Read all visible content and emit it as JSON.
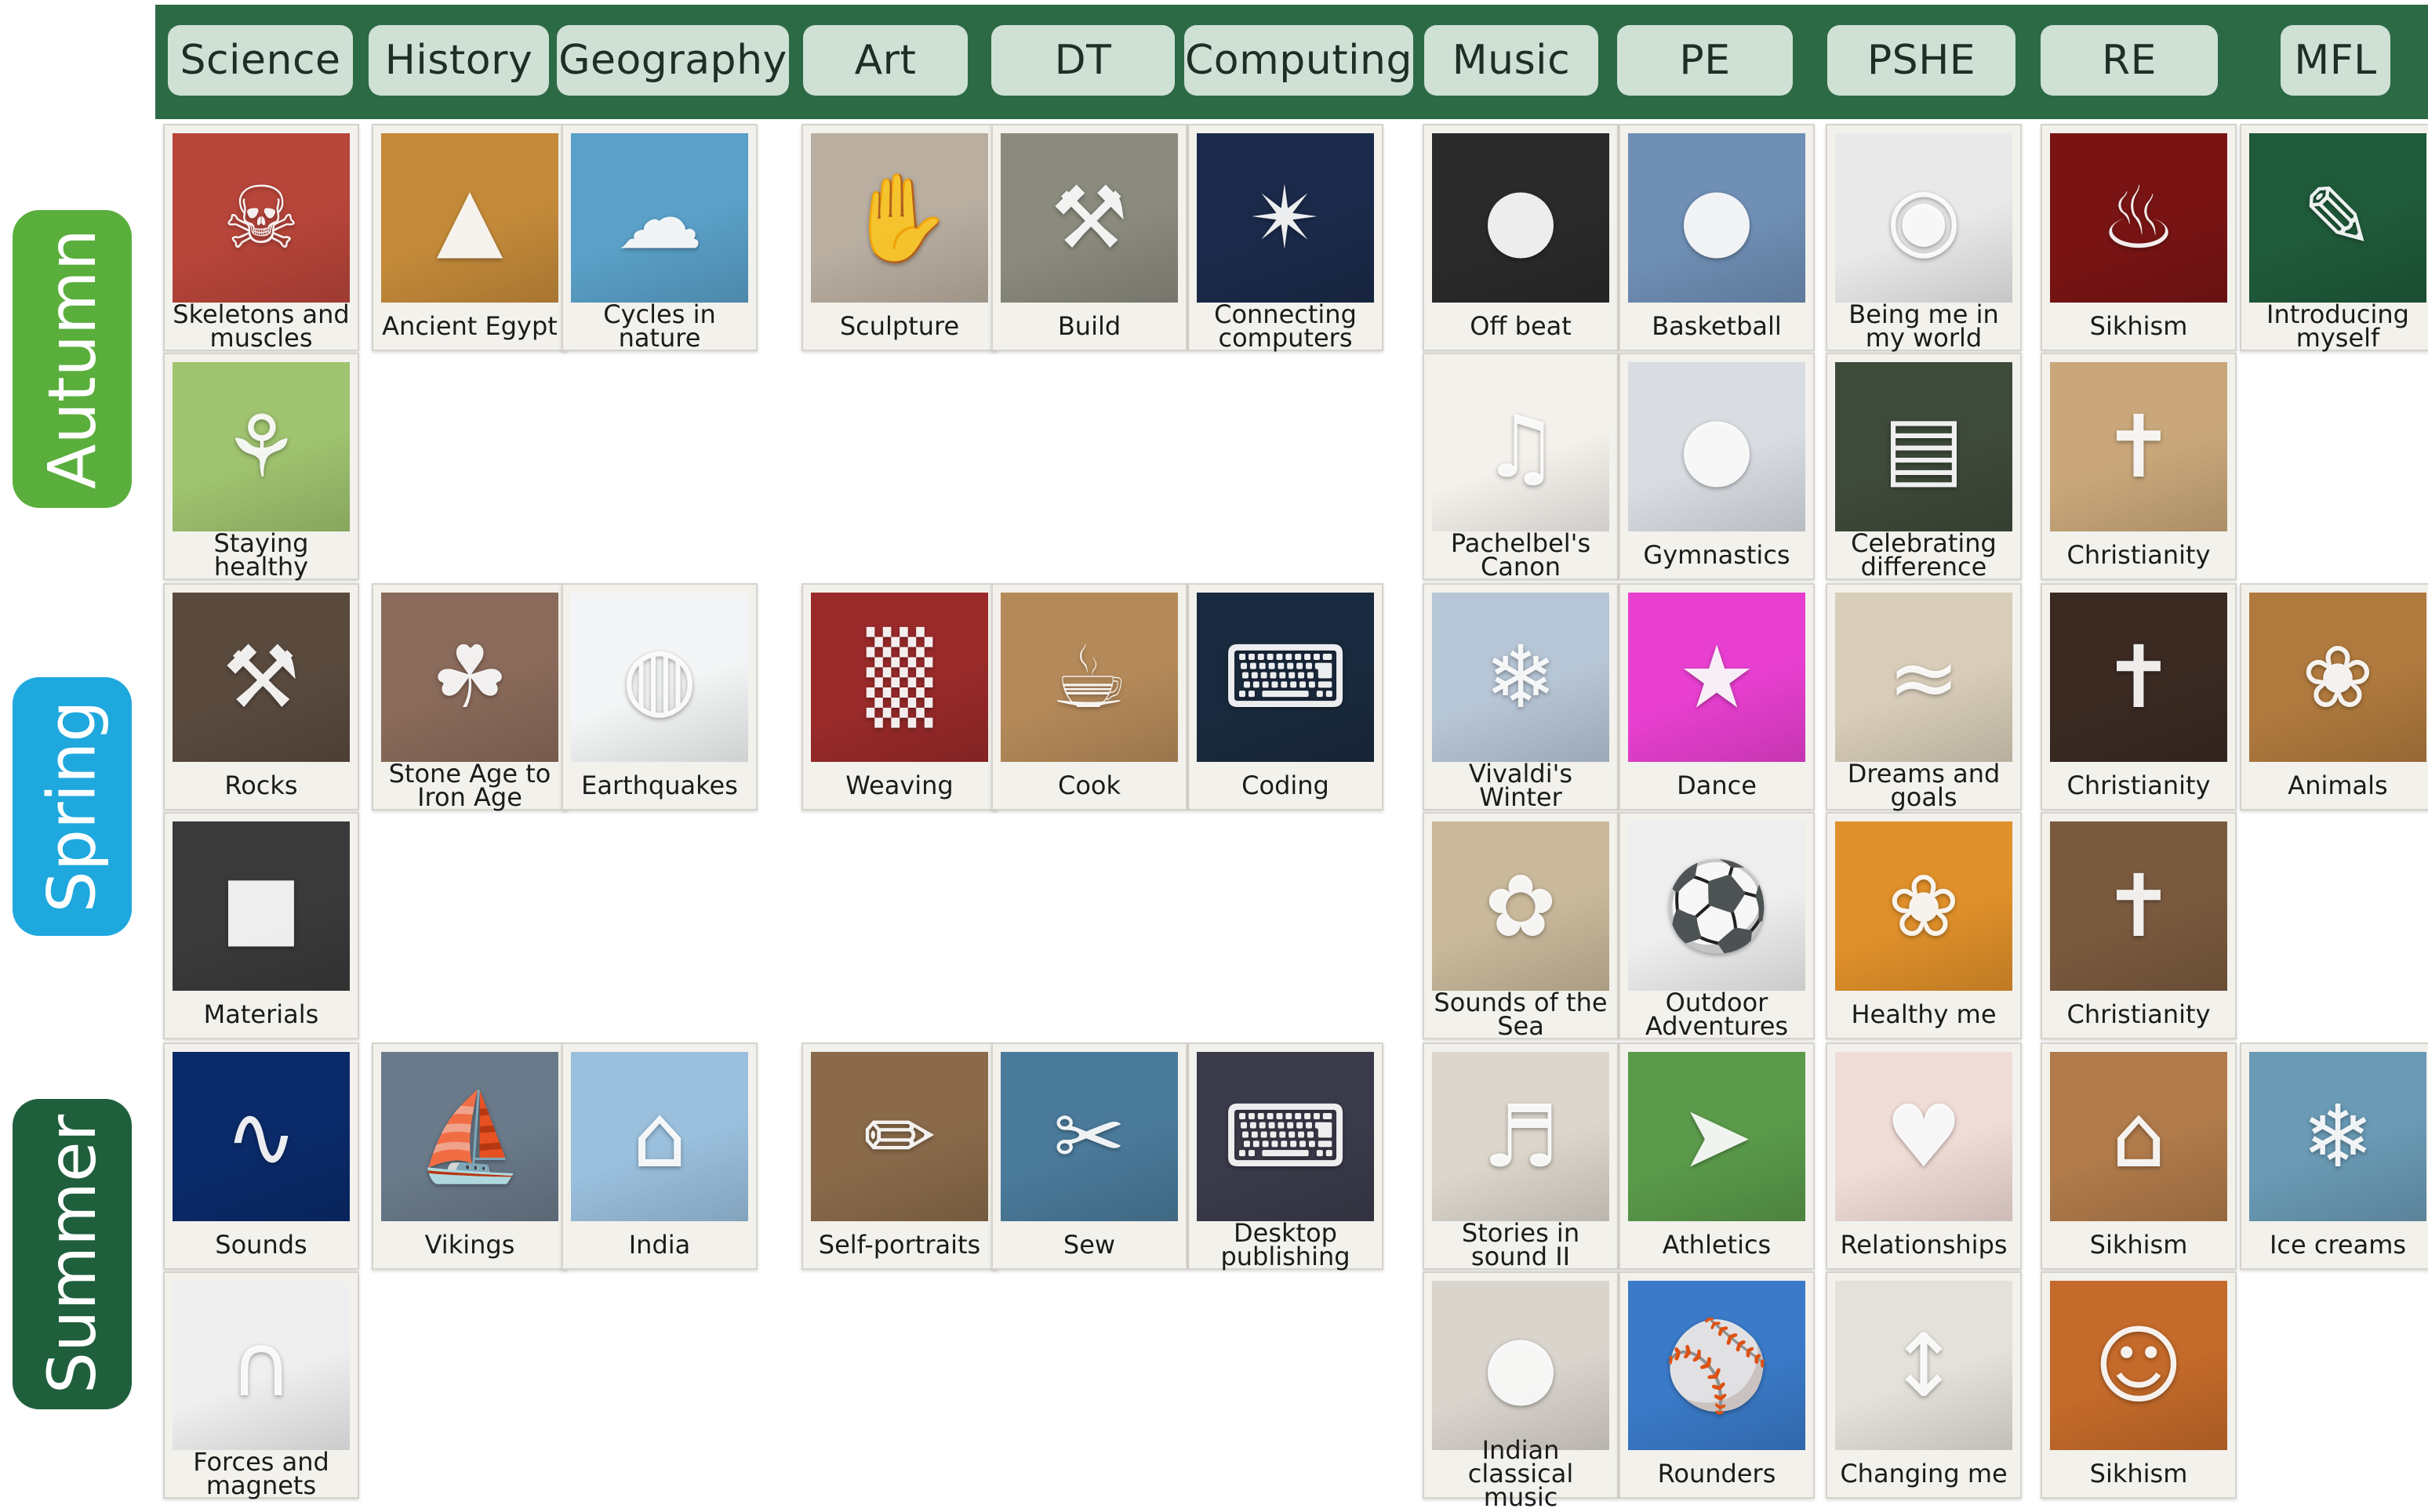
{
  "subjects": [
    "Science",
    "History",
    "Geography",
    "Art",
    "DT",
    "Computing",
    "Music",
    "PE",
    "PSHE",
    "RE",
    "MFL"
  ],
  "terms": [
    {
      "label": "Autumn",
      "color": "#5aae3c"
    },
    {
      "label": "Spring",
      "color": "#1fa8de"
    },
    {
      "label": "Summer",
      "color": "#1f5f3c"
    }
  ],
  "colors": {
    "header": "#2c6a45",
    "pill": "#cfe0d5",
    "card": "#f2f1ec"
  },
  "topics": [
    {
      "label": "Skeletons and muscles",
      "subject": "Science",
      "term": "Autumn",
      "icon": "skeleton-icon",
      "color": "#b8453a"
    },
    {
      "label": "Ancient Egypt",
      "subject": "History",
      "term": "Autumn",
      "icon": "pyramid-icon",
      "color": "#c48a3a"
    },
    {
      "label": "Sculpture",
      "subject": "Art",
      "term": "Autumn",
      "icon": "clay-hands-icon",
      "color": "#b9aea0"
    },
    {
      "label": "Connecting computers",
      "subject": "Computing",
      "term": "Autumn",
      "icon": "network-globe-icon",
      "color": "#1b2a4a"
    },
    {
      "label": "Off beat",
      "subject": "Music",
      "term": "Autumn",
      "icon": "drum-icon",
      "color": "#2a2a2a"
    },
    {
      "label": "Basketball",
      "subject": "PE",
      "term": "Autumn",
      "icon": "basketball-icon",
      "color": "#6f8fb5"
    },
    {
      "label": "Being me in my world",
      "subject": "PSHE",
      "term": "Autumn",
      "icon": "globe-hands-icon",
      "color": "#e9e9ea"
    },
    {
      "label": "Sikhism",
      "subject": "RE",
      "term": "Autumn",
      "icon": "diya-lamp-icon",
      "color": "#7a1414"
    },
    {
      "label": "Introducing myself",
      "subject": "MFL",
      "term": "Autumn",
      "icon": "chalkboard-icon",
      "color": "#1f5a3a"
    },
    {
      "label": "Staying healthy",
      "subject": "Science",
      "term": "Autumn",
      "icon": "test-tube-plant-icon",
      "color": "#9fc36f"
    },
    {
      "label": "Cycles in nature",
      "subject": "Geography",
      "term": "Autumn",
      "icon": "water-cycle-icon",
      "color": "#5aa0c8"
    },
    {
      "label": "Build",
      "subject": "DT",
      "term": "Autumn",
      "icon": "toy-digger-icon",
      "color": "#8a8a7e"
    },
    {
      "label": "Pachelbel's Canon",
      "subject": "Music",
      "term": "Autumn",
      "icon": "violin-icon",
      "color": "#f4f1ec"
    },
    {
      "label": "Gymnastics",
      "subject": "PE",
      "term": "Autumn",
      "icon": "gym-ball-icon",
      "color": "#d9dde2"
    },
    {
      "label": "Celebrating difference",
      "subject": "PSHE",
      "term": "Autumn",
      "icon": "equity-blocks-icon",
      "color": "#3e4a3a"
    },
    {
      "label": "Christianity",
      "subject": "RE",
      "term": "Autumn",
      "icon": "cross-icon",
      "color": "#c9a77a"
    },
    {
      "label": "Rocks",
      "subject": "Science",
      "term": "Spring",
      "icon": "hammer-icon",
      "color": "#5a4a3e"
    },
    {
      "label": "Stone Age to Iron Age",
      "subject": "History",
      "term": "Spring",
      "icon": "cave-art-icon",
      "color": "#8a6a5a"
    },
    {
      "label": "Weaving",
      "subject": "Art",
      "term": "Spring",
      "icon": "loom-icon",
      "color": "#9a2a2a"
    },
    {
      "label": "Coding",
      "subject": "Computing",
      "term": "Spring",
      "icon": "code-screen-icon",
      "color": "#1a2a3e"
    },
    {
      "label": "Vivaldi's Winter",
      "subject": "Music",
      "term": "Spring",
      "icon": "snowy-forest-icon",
      "color": "#b7c6d6"
    },
    {
      "label": "Dance",
      "subject": "PE",
      "term": "Spring",
      "icon": "dancer-icon",
      "color": "#e83fd0"
    },
    {
      "label": "Dreams and goals",
      "subject": "PSHE",
      "term": "Spring",
      "icon": "sand-writing-icon",
      "color": "#d8cdb9"
    },
    {
      "label": "Christianity",
      "subject": "RE",
      "term": "Spring",
      "icon": "tomb-cross-icon",
      "color": "#3a2a22"
    },
    {
      "label": "Animals",
      "subject": "MFL",
      "term": "Spring",
      "icon": "cow-icon",
      "color": "#b07a3e"
    },
    {
      "label": "Materials",
      "subject": "Science",
      "term": "Spring",
      "icon": "butter-pan-icon",
      "color": "#3a3a3a"
    },
    {
      "label": "Earthquakes",
      "subject": "Geography",
      "term": "Spring",
      "icon": "earth-globe-icon",
      "color": "#f3f5f6"
    },
    {
      "label": "Cook",
      "subject": "DT",
      "term": "Spring",
      "icon": "cooking-icon",
      "color": "#b58a5a"
    },
    {
      "label": "Sounds of the Sea",
      "subject": "Music",
      "term": "Spring",
      "icon": "seashell-icon",
      "color": "#c9b89a"
    },
    {
      "label": "Outdoor Adventures",
      "subject": "PE",
      "term": "Spring",
      "icon": "sports-balls-icon",
      "color": "#eeeeee"
    },
    {
      "label": "Healthy me",
      "subject": "PSHE",
      "term": "Spring",
      "icon": "fruit-veg-icon",
      "color": "#e0902a"
    },
    {
      "label": "Christianity",
      "subject": "RE",
      "term": "Spring",
      "icon": "crucifix-icon",
      "color": "#7a5a3e"
    },
    {
      "label": "Sounds",
      "subject": "Science",
      "term": "Summer",
      "icon": "sound-wave-icon",
      "color": "#0a2a6a"
    },
    {
      "label": "Vikings",
      "subject": "History",
      "term": "Summer",
      "icon": "viking-ship-icon",
      "color": "#6a7a8a"
    },
    {
      "label": "Self-portraits",
      "subject": "Art",
      "term": "Summer",
      "icon": "sketch-easel-icon",
      "color": "#8a6a4a"
    },
    {
      "label": "Desktop publishing",
      "subject": "Computing",
      "term": "Summer",
      "icon": "computer-class-icon",
      "color": "#3a3a4a"
    },
    {
      "label": "Stories in sound II",
      "subject": "Music",
      "term": "Summer",
      "icon": "instruments-icon",
      "color": "#dcd6cc"
    },
    {
      "label": "Athletics",
      "subject": "PE",
      "term": "Summer",
      "icon": "runner-icon",
      "color": "#5a9a4a"
    },
    {
      "label": "Relationships",
      "subject": "PSHE",
      "term": "Summer",
      "icon": "heart-hands-icon",
      "color": "#f0dcd6"
    },
    {
      "label": "Sikhism",
      "subject": "RE",
      "term": "Summer",
      "icon": "golden-temple-icon",
      "color": "#b07a4a"
    },
    {
      "label": "Ice creams",
      "subject": "MFL",
      "term": "Summer",
      "icon": "ice-cream-icon",
      "color": "#6a9ab5"
    },
    {
      "label": "Forces and magnets",
      "subject": "Science",
      "term": "Summer",
      "icon": "magnet-icon",
      "color": "#efefef"
    },
    {
      "label": "India",
      "subject": "Geography",
      "term": "Summer",
      "icon": "taj-mahal-icon",
      "color": "#9ac0de"
    },
    {
      "label": "Sew",
      "subject": "DT",
      "term": "Summer",
      "icon": "child-sewing-icon",
      "color": "#4a7a9a"
    },
    {
      "label": "Indian classical music",
      "subject": "Music",
      "term": "Summer",
      "icon": "tabla-drum-icon",
      "color": "#d9d4cc"
    },
    {
      "label": "Rounders",
      "subject": "PE",
      "term": "Summer",
      "icon": "baseball-icon",
      "color": "#3a7ac8"
    },
    {
      "label": "Changing me",
      "subject": "PSHE",
      "term": "Summer",
      "icon": "measuring-height-icon",
      "color": "#e4e0da"
    },
    {
      "label": "Sikhism",
      "subject": "RE",
      "term": "Summer",
      "icon": "praying-child-icon",
      "color": "#c46a2a"
    }
  ]
}
